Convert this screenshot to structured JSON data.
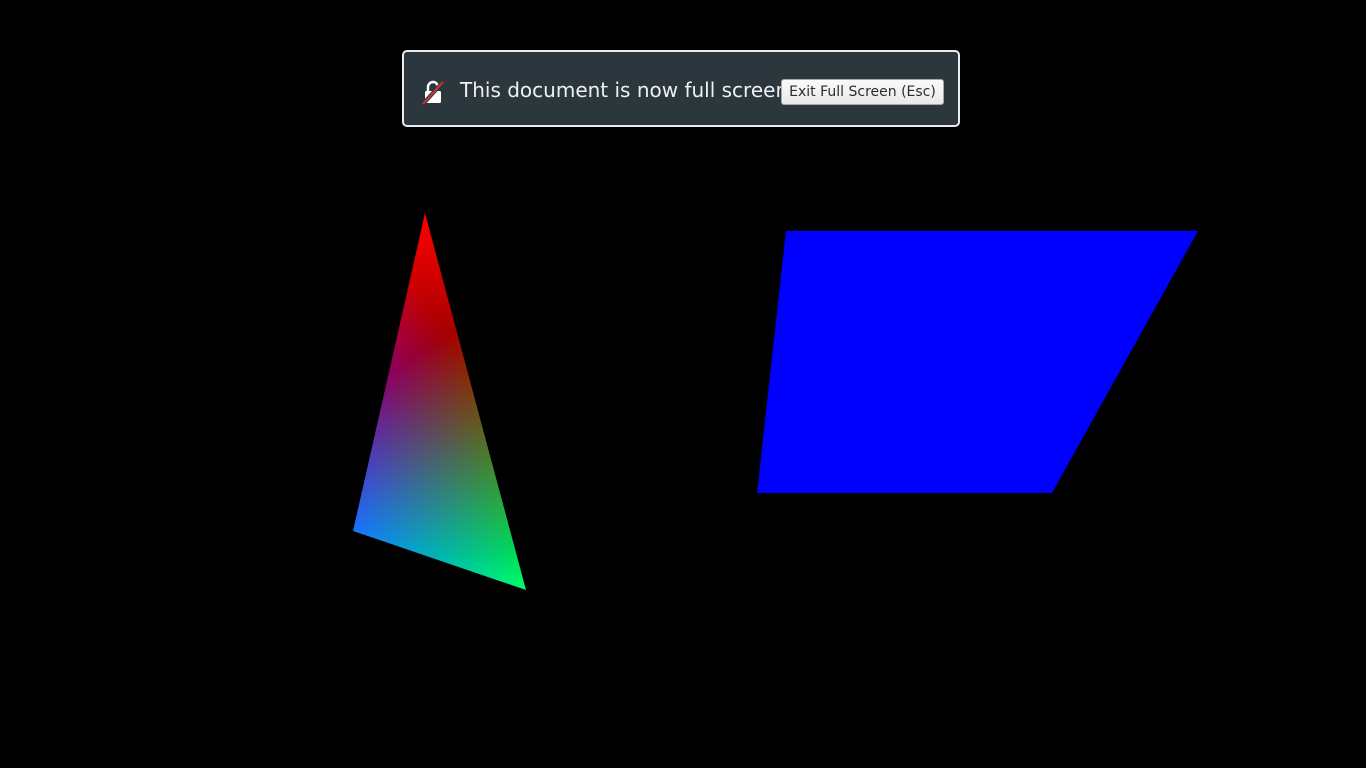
{
  "notice": {
    "message": "This document is now full screen",
    "exit_button_label": "Exit Full Screen (Esc)",
    "icon": "padlock-slash-icon"
  },
  "scene": {
    "background_color": "#000000",
    "triangle": {
      "fill": "vertex-color-gradient",
      "vertex_colors": [
        "#ff0000",
        "#0000ff",
        "#00ff00"
      ]
    },
    "parallelogram": {
      "fill": "#0000ff"
    }
  }
}
